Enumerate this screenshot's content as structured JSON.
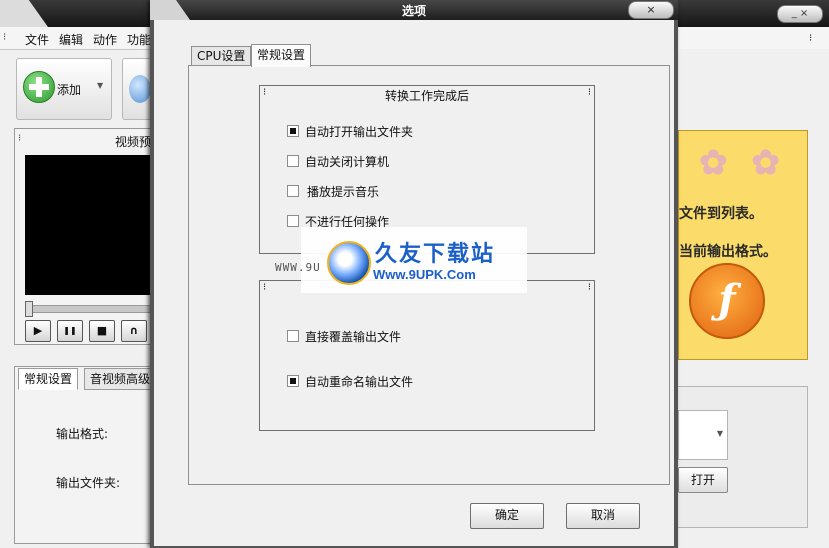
{
  "main_window": {
    "menu": [
      "文件",
      "编辑",
      "动作",
      "功能"
    ],
    "toolbar": {
      "add_label": "添加"
    },
    "preview": {
      "title": "视频预"
    },
    "player_buttons": [
      "▶",
      "❚❚",
      "■",
      "∩"
    ],
    "bottom_tabs": [
      "常规设置",
      "音视频高级"
    ],
    "fields": {
      "output_format_label": "输出格式:",
      "output_folder_label": "输出文件夹:"
    },
    "banner": {
      "line1": "文件到列表。",
      "line2": "当前输出格式。",
      "logo_glyph": "ƒ"
    },
    "open_button": "打开"
  },
  "dialog": {
    "title": "选项",
    "close_glyph": "×",
    "tabs": [
      {
        "label": "CPU设置",
        "active": false
      },
      {
        "label": "常规设置",
        "active": true
      }
    ],
    "group1": {
      "title": "转换工作完成后",
      "options": [
        {
          "label": "自动打开输出文件夹",
          "checked": true
        },
        {
          "label": "自动关闭计算机",
          "checked": false
        },
        {
          "label": "播放提示音乐",
          "checked": false
        },
        {
          "label": "不进行任何操作",
          "checked": false
        }
      ]
    },
    "group2": {
      "title": "",
      "options": [
        {
          "label": "直接覆盖输出文件",
          "checked": false
        },
        {
          "label": "自动重命名输出文件",
          "checked": true
        }
      ]
    },
    "buttons": {
      "ok": "确定",
      "cancel": "取消"
    }
  },
  "watermark": {
    "left_text": "WWW.9U",
    "title": "久友下载站",
    "url": "Www.9UPK.Com"
  }
}
